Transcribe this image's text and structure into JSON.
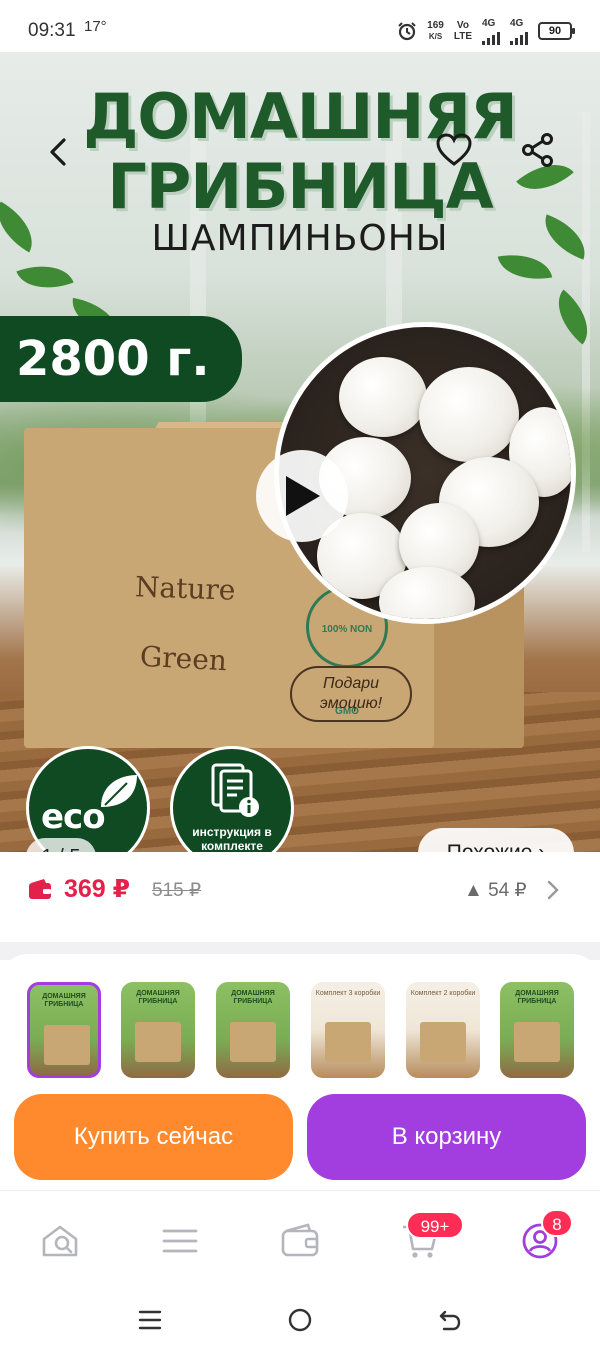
{
  "status_bar": {
    "time": "09:31",
    "temperature": "17°",
    "net_speed_value": "169",
    "net_speed_unit": "K/S",
    "volte_top": "Vo",
    "volte_bottom": "LTE",
    "sim1": "4G",
    "sim2": "4G",
    "battery": "90"
  },
  "hero": {
    "title_line1": "ДОМАШНЯЯ",
    "title_line2": "ГРИБНИЦА",
    "subtitle": "ШАМПИНЬОНЫ",
    "weight": "2800 г.",
    "box_text_1": "Nature",
    "box_text_2": "Green",
    "stamp_text": "100% NON GMO",
    "gift_text": "Подари эмоцию!",
    "eco_label": "eco",
    "instruction_label": "инструкция в комплекте",
    "image_counter": "1 / 5",
    "similar_button": "Похожие ›"
  },
  "price": {
    "current": "369 ₽",
    "old": "515 ₽",
    "points": "▲ 54 ₽"
  },
  "thumbnails": [
    {
      "caption": "ДОМАШНЯЯ ГРИБНИЦА",
      "style": "green",
      "selected": true
    },
    {
      "caption": "ДОМАШНЯЯ ГРИБНИЦА",
      "style": "green",
      "selected": false
    },
    {
      "caption": "ДОМАШНЯЯ ГРИБНИЦА",
      "style": "green",
      "selected": false
    },
    {
      "caption": "Комплект 3 коробки",
      "style": "plain",
      "selected": false
    },
    {
      "caption": "Комплект 2 коробки",
      "style": "plain",
      "selected": false
    },
    {
      "caption": "ДОМАШНЯЯ ГРИБНИЦА",
      "style": "green",
      "selected": false
    }
  ],
  "actions": {
    "buy_now": "Купить сейчас",
    "add_to_cart": "В корзину"
  },
  "tabbar": {
    "cart_badge": "99+",
    "profile_badge": "8"
  },
  "colors": {
    "accent_purple": "#a23de0",
    "accent_orange": "#ff8a2e",
    "price_red": "#e3224b",
    "brand_green": "#0f4a22"
  }
}
